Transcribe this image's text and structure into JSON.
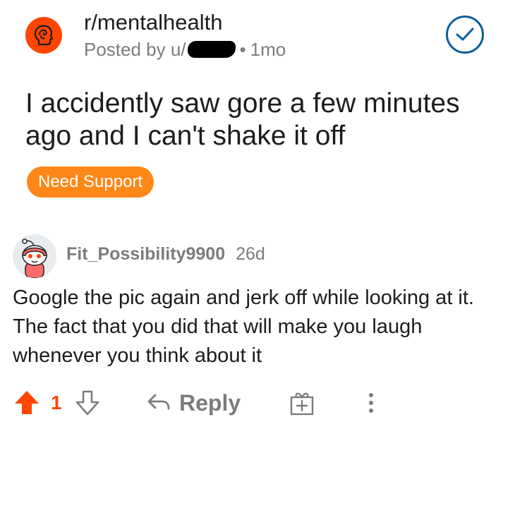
{
  "post": {
    "community": "r/mentalhealth",
    "posted_by_prefix": "Posted by u/",
    "separator": "•",
    "age": "1mo",
    "title": "I accidently saw gore a few minutes ago and I can't shake it off",
    "flair": "Need Support"
  },
  "comment": {
    "author": "Fit_Possibility9900",
    "age": "26d",
    "body": "Google the pic again and jerk off while looking at it. The fact that you did that will make you laugh whenever you think about it",
    "score": "1",
    "reply_label": "Reply"
  },
  "icons": {
    "community": "mental-health-head-icon",
    "joined": "check-circle-icon",
    "upvote": "upvote-arrow-icon",
    "downvote": "downvote-arrow-icon",
    "reply": "reply-arrow-icon",
    "award": "gift-box-icon",
    "more": "vertical-dots-icon"
  },
  "colors": {
    "brand_orange": "#ff4500",
    "flair_orange": "#ff8717",
    "check_blue": "#0a5f9b",
    "meta_gray": "#7c7c7c"
  }
}
